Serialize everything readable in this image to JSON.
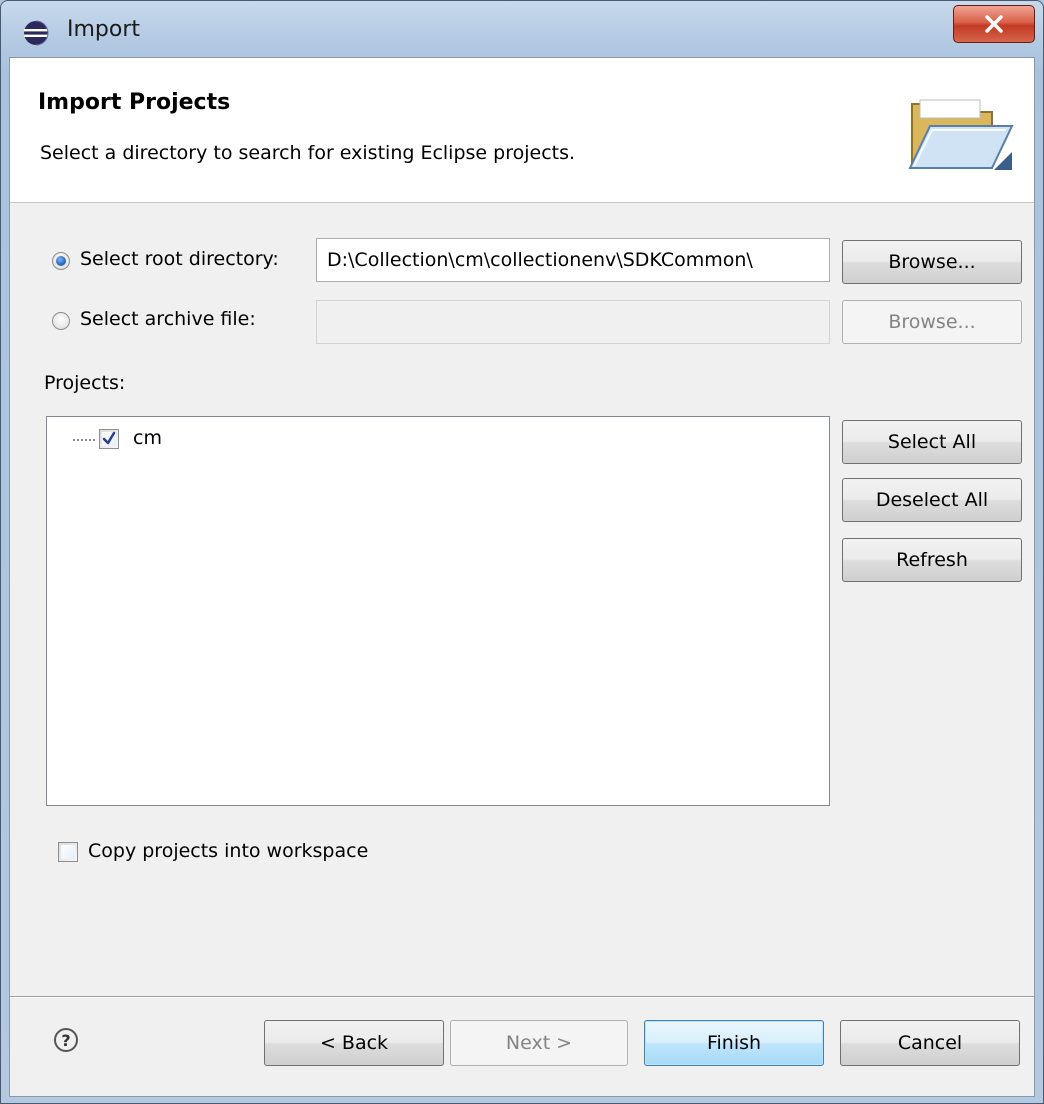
{
  "window": {
    "title": "Import"
  },
  "banner": {
    "title": "Import Projects",
    "description": "Select a directory to search for existing Eclipse projects."
  },
  "source": {
    "root_directory_label": "Select root directory:",
    "root_directory_value": "D:\\Collection\\cm\\collectionenv\\SDKCommon\\",
    "root_directory_selected": true,
    "archive_file_label": "Select archive file:",
    "archive_file_value": "",
    "archive_file_selected": false,
    "browse_label": "Browse..."
  },
  "projects": {
    "label": "Projects:",
    "items": [
      {
        "name": "cm",
        "checked": true
      }
    ],
    "select_all_label": "Select All",
    "deselect_all_label": "Deselect All",
    "refresh_label": "Refresh"
  },
  "options": {
    "copy_into_workspace_label": "Copy projects into workspace",
    "copy_into_workspace_checked": false
  },
  "footer": {
    "help_glyph": "?",
    "back_label": "< Back",
    "next_label": "Next >",
    "finish_label": "Finish",
    "cancel_label": "Cancel"
  },
  "colors": {
    "accent": "#3c7fb1",
    "close_button": "#c23a24"
  },
  "icons": {
    "app": "eclipse-icon",
    "banner": "folder-open-icon",
    "close": "close-icon",
    "help": "help-icon"
  }
}
